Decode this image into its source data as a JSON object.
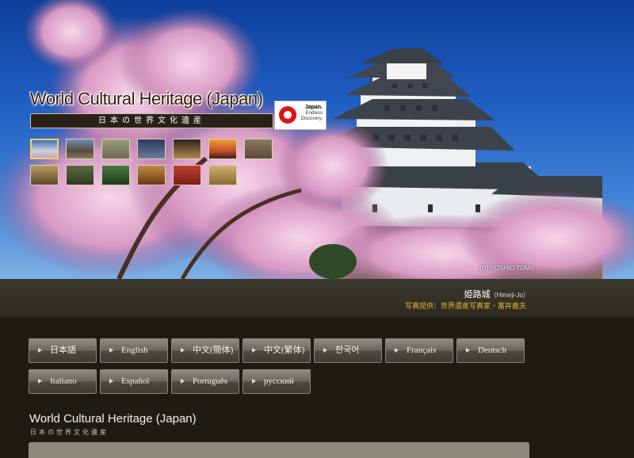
{
  "hero": {
    "title": "World Cultural Heritage (Japan)",
    "subtitle_jp": "日本の世界文化遺産",
    "badge_lines": [
      "Japan.",
      "Endless",
      "Discovery."
    ],
    "photo_copyright": "(C) YOSHIO TOMII",
    "thumbnails": [
      {
        "label": "Himeji-jo thumbnail",
        "selected": true
      },
      {
        "label": "Temple thumbnail 2"
      },
      {
        "label": "Temple thumbnail 3"
      },
      {
        "label": "Thumbnail 4"
      },
      {
        "label": "Thumbnail 5"
      },
      {
        "label": "Torii thumbnail 6"
      },
      {
        "label": "Statue thumbnail 7"
      },
      {
        "label": "Thumbnail 8"
      },
      {
        "label": "Thumbnail 9"
      },
      {
        "label": "Forest thumbnail 10"
      },
      {
        "label": "Thumbnail 11"
      },
      {
        "label": "Thumbnail 12"
      },
      {
        "label": "Thumbnail 13"
      }
    ]
  },
  "caption": {
    "name": "姫路城",
    "romaji": "（Himeji-Jo）",
    "credit": "写真提供：世界遺産写真家・富井義夫"
  },
  "languages": [
    "日本語",
    "English",
    "中文(簡体)",
    "中文(繁体)",
    "한국어",
    "Français",
    "Deutsch",
    "Italiano",
    "Español",
    "Português",
    "русский"
  ],
  "section": {
    "heading": "World Cultural Heritage (Japan)",
    "subheading": "日本の世界文化遺産"
  },
  "colors": {
    "sky": "#1f5cc0",
    "bg": "#1e1b12",
    "credit": "#e6b62c",
    "button": "#6c685e"
  }
}
